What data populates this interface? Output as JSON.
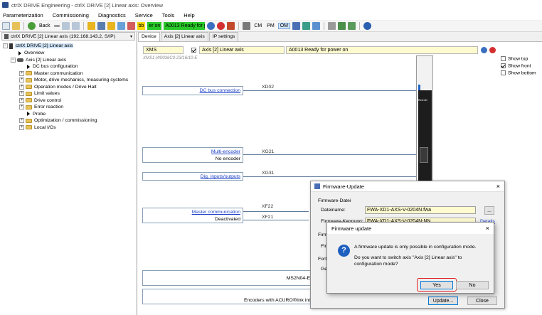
{
  "window": {
    "title": "ctrlX DRIVE Engineering - ctrlX DRIVE [2] Linear axis: Overview"
  },
  "menu": [
    "Parameterization",
    "Commissioning",
    "Diagnostics",
    "Service",
    "Tools",
    "Help"
  ],
  "toolbar": {
    "back_label": "Back",
    "bb_label": "bb",
    "status_label": "er on",
    "status_message": "A0013 Ready for po",
    "cm_label": "CM",
    "pm_label": "PM",
    "om_label": "OM"
  },
  "left_panel": {
    "device_selector": "ctrlX DRIVE [2] Linear axis (192.168.143.2, S/IP)",
    "tree": [
      {
        "label": "ctrlX DRIVE [2] Linear axis",
        "level": 0,
        "kind": "device",
        "selected": true
      },
      {
        "label": "Overview",
        "level": 1,
        "kind": "arrow"
      },
      {
        "label": "Axis [2] Linear axis",
        "level": 1,
        "kind": "axis"
      },
      {
        "label": "DC bus configuration",
        "level": 2,
        "kind": "arrow"
      },
      {
        "label": "Master communication",
        "level": 2,
        "kind": "folder"
      },
      {
        "label": "Motor, drive mechanics, measuring systems",
        "level": 2,
        "kind": "folder"
      },
      {
        "label": "Operation modes / Drive Halt",
        "level": 2,
        "kind": "folder"
      },
      {
        "label": "Limit values",
        "level": 2,
        "kind": "folder"
      },
      {
        "label": "Drive control",
        "level": 2,
        "kind": "folder"
      },
      {
        "label": "Error reaction",
        "level": 2,
        "kind": "folder"
      },
      {
        "label": "Probe",
        "level": 2,
        "kind": "arrow"
      },
      {
        "label": "Optimization / commissioning",
        "level": 2,
        "kind": "folder"
      },
      {
        "label": "Local I/Os",
        "level": 2,
        "kind": "folder"
      }
    ]
  },
  "tabs": [
    "Device",
    "Axis [2] Linear axis",
    "IP settings"
  ],
  "overview": {
    "device_type": "XMS",
    "axis_name": "Axis [2] Linear axis",
    "status": "A0013 Ready for power on",
    "type_code": "XMS1-W0036C0-23/16/10-E",
    "show_options": [
      {
        "label": "Show top",
        "checked": false
      },
      {
        "label": "Show front",
        "checked": true
      },
      {
        "label": "Show bottom",
        "checked": false
      }
    ],
    "interfaces": [
      {
        "link": "DC bus connection",
        "port": "XD02",
        "sub": ""
      },
      {
        "link": "Multi-encoder",
        "port": "XG21",
        "sub": "No encoder"
      },
      {
        "link": "Dig. inputs/outputs",
        "port": "XG31",
        "sub": ""
      },
      {
        "link": "Master communication",
        "port": "XF22",
        "sub": "Deactivated",
        "port2": "XF21"
      }
    ],
    "bottom_items": [
      "MS2N04-E",
      "Encoders with ACURO®link int"
    ],
    "drive_label": "Rexroth"
  },
  "firmware_window": {
    "title": "Firmware-Update",
    "group1": "Firmware-Datei",
    "file_label": "Dateiname:",
    "file_value": "FWA-XD1-AXS-V-0204N.fwa",
    "browse_label": "...",
    "version_label": "Firmware-Kennung:",
    "version_value": "FWA-XD1-AXS-V-0204N-NN",
    "details_label": "Details",
    "group2_label": "Firm",
    "row2_label": "Firm",
    "group3_label": "Fortsc",
    "row3_label": "Gesa",
    "update_label": "Update...",
    "close_label": "Close"
  },
  "dialog": {
    "title": "Firmware update",
    "close_label": "×",
    "line1": "A firmware update is only possible in configuration mode.",
    "line2": "Do you want to switch axis \"Axis [2] Linear axis\" to",
    "line3": "configuration mode?",
    "yes_label": "Yes",
    "no_label": "No"
  },
  "colors": {
    "accent": "#1a3fc9",
    "status_green": "#28c828",
    "yes_highlight": "#e02020"
  }
}
